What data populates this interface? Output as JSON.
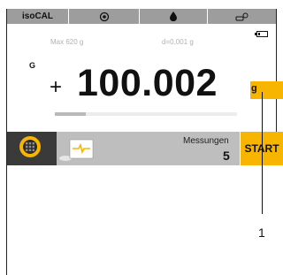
{
  "status_bar": {
    "title": "isoCAL",
    "icons": [
      "level-icon",
      "drop-icon",
      "user-icon"
    ]
  },
  "display": {
    "max_capacity": "Max 620 g",
    "readability": "d=0,001 g",
    "gross_indicator": "G",
    "sign": "+",
    "weight_value": "100.002",
    "unit": "g",
    "progress_fraction": 0.17
  },
  "function_bar": {
    "measurements_label": "Messungen",
    "measurements_count": "5",
    "start_label": "START"
  },
  "callout": {
    "number": "1"
  },
  "colors": {
    "accent": "#f7b500",
    "status_bar": "#9d9d9d",
    "function_bar": "#bebebe",
    "menu_button": "#3a3a3a"
  }
}
